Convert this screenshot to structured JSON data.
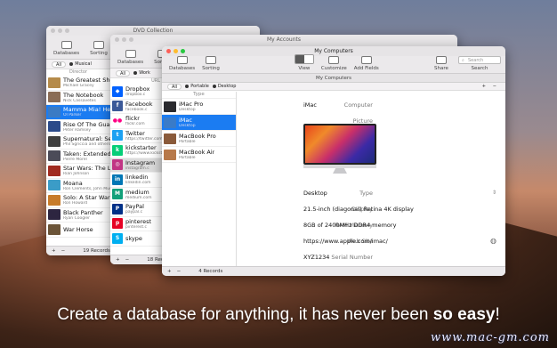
{
  "colors": {
    "accent": "#1b7cf2",
    "selected_row": "#dcdcdc"
  },
  "dvd": {
    "title": "DVD Collection",
    "toolbar": [
      "Databases",
      "Sorting"
    ],
    "scope": [
      "All",
      "Musical"
    ],
    "header": "Director",
    "rows": [
      {
        "title": "The Greatest Showman",
        "sub": "Michael Gracey",
        "color": "#b58b4a"
      },
      {
        "title": "The Notebook",
        "sub": "Nick Cassavetes",
        "color": "#8a6c55"
      },
      {
        "title": "Mamma Mia! Here We Go Again",
        "sub": "Ol Parker",
        "color": "#3b7bc4"
      },
      {
        "title": "Rise Of The Guardians",
        "sub": "Peter Ramsey",
        "color": "#2a4a8a"
      },
      {
        "title": "Supernatural: Season 1",
        "sub": "Phil Sgriccia and others",
        "color": "#3e3e3e"
      },
      {
        "title": "Taken: Extended Harder Cut",
        "sub": "Pierre Morel",
        "color": "#4b4b58"
      },
      {
        "title": "Star Wars: The Last Jedi",
        "sub": "Rian Johnson",
        "color": "#a02a20"
      },
      {
        "title": "Moana",
        "sub": "Ron Clements, John Musker",
        "color": "#3b9cc7"
      },
      {
        "title": "Solo: A Star Wars Story",
        "sub": "Ron Howard",
        "color": "#c77b2a"
      },
      {
        "title": "Black Panther",
        "sub": "Ryan Coogler",
        "color": "#2d2540"
      },
      {
        "title": "War Horse",
        "sub": "",
        "color": "#6b5438"
      }
    ],
    "record_count": "19 Records"
  },
  "accounts": {
    "title": "My Accounts",
    "toolbar": [
      "Databases",
      "Sorting"
    ],
    "scope": [
      "All",
      "Work"
    ],
    "header": "URL",
    "rows": [
      {
        "title": "Dropbox",
        "sub": "dropbox.c",
        "color": "#0061fe",
        "glyph": "◆"
      },
      {
        "title": "Facebook",
        "sub": "facebook.c",
        "color": "#3b5998",
        "glyph": "f"
      },
      {
        "title": "flickr",
        "sub": "flickr.com",
        "color": "#ffffff",
        "glyph": "●●"
      },
      {
        "title": "Twitter",
        "sub": "https://twitter.com/ap",
        "color": "#1da1f2",
        "glyph": "t"
      },
      {
        "title": "kickstarter",
        "sub": "https://www.kickstarter",
        "color": "#05ce78",
        "glyph": "k"
      },
      {
        "title": "Instagram",
        "sub": "instagram.c",
        "color": "#c13584",
        "glyph": "◎"
      },
      {
        "title": "linkedin",
        "sub": "linkedin.com",
        "color": "#0077b5",
        "glyph": "in"
      },
      {
        "title": "medium",
        "sub": "medium.com",
        "color": "#12a07a",
        "glyph": "M"
      },
      {
        "title": "PayPal",
        "sub": "paypal.c",
        "color": "#003087",
        "glyph": "P"
      },
      {
        "title": "pinterest",
        "sub": "pinterest.c",
        "color": "#e60023",
        "glyph": "p"
      },
      {
        "title": "skype",
        "sub": "",
        "color": "#00aff0",
        "glyph": "S"
      }
    ],
    "record_count": "18 Records"
  },
  "computers": {
    "title": "My Computers",
    "subtitle": "My Computers",
    "toolbar": {
      "databases": "Databases",
      "sorting": "Sorting",
      "view": "View",
      "customize": "Customize",
      "add_fields": "Add Fields",
      "share": "Share",
      "search": "Search",
      "search_placeholder": "Search"
    },
    "scope": [
      "All",
      "Portable",
      "Desktop"
    ],
    "list_header": "Type",
    "list": [
      {
        "title": "iMac Pro",
        "sub": "Desktop",
        "color": "#2a2a2e"
      },
      {
        "title": "iMac",
        "sub": "Desktop",
        "color": "#3a7bc8"
      },
      {
        "title": "MacBook Pro",
        "sub": "Portable",
        "color": "#8a5a3a"
      },
      {
        "title": "MacBook Air",
        "sub": "Portable",
        "color": "#b7794a"
      }
    ],
    "record_count": "4 Records",
    "detail": {
      "computer_label": "Computer",
      "computer_value": "iMac",
      "picture_label": "Picture",
      "type_label": "Type",
      "type_value": "Desktop",
      "display_label": "Display",
      "display_value": "21.5-inch (diagonal) Retina 4K display",
      "ram_label": "RAM Memory",
      "ram_value": "8GB of 2400MHz DDR4 memory",
      "web_label": "Web Site",
      "web_value": "https://www.apple.com/imac/",
      "serial_label": "Serial Number",
      "serial_value": "XYZ1234"
    }
  },
  "caption": {
    "main": "Create a database for anything, it has never been ",
    "bold": "so easy",
    "end": "!"
  },
  "watermark": "www.mac-gm.com"
}
